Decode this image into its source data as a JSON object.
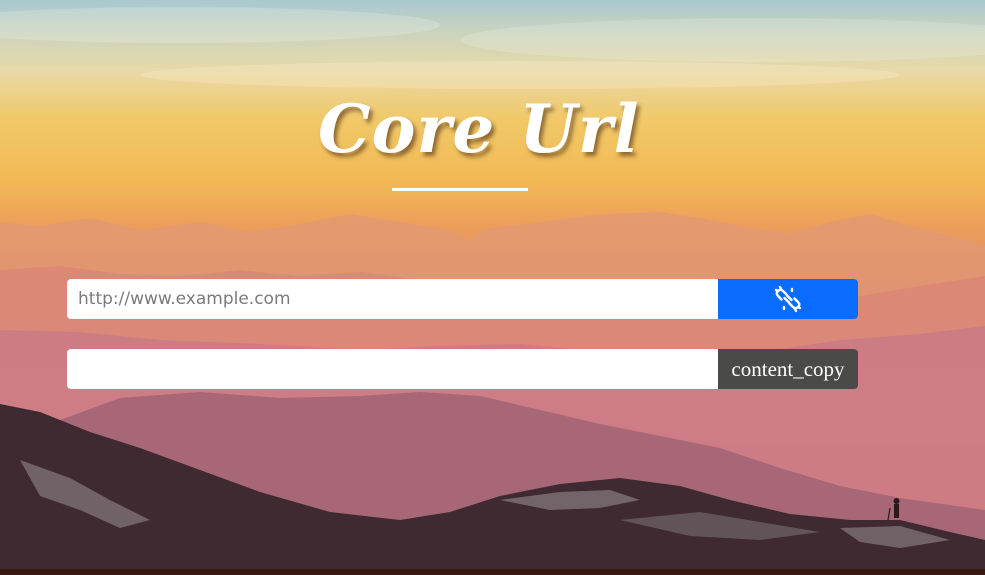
{
  "header": {
    "title": "Core Url"
  },
  "shorten_form": {
    "url_input": {
      "value": "",
      "placeholder": "http://www.example.com"
    },
    "shorten_button_icon": "link-off-icon"
  },
  "result_form": {
    "short_url_output": {
      "value": ""
    },
    "copy_button_label": "content_copy"
  },
  "colors": {
    "shorten_button": "#0a6cff",
    "copy_button": "#4a4a48",
    "field_background": "#ffffff"
  }
}
